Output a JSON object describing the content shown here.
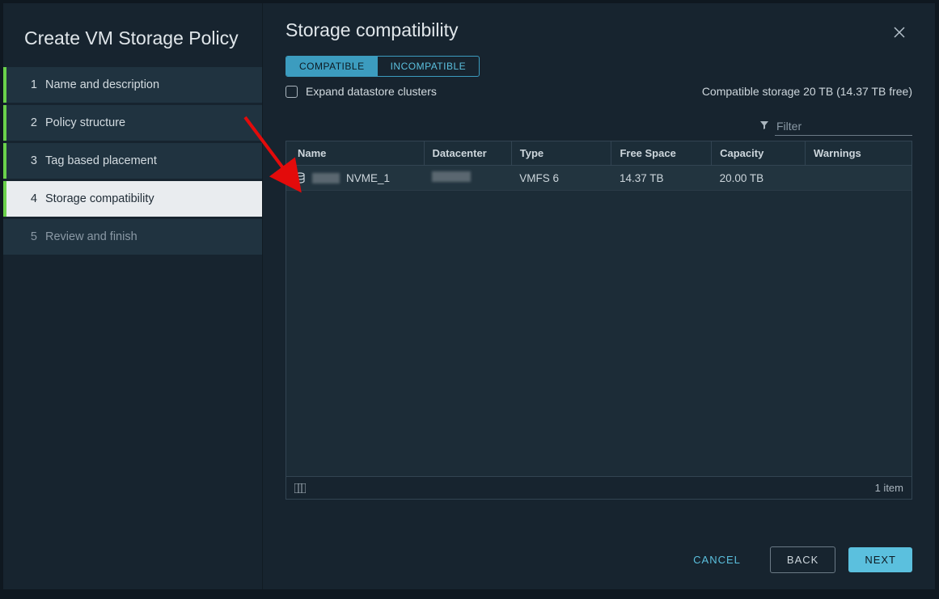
{
  "sidebar": {
    "title": "Create VM Storage Policy",
    "steps": [
      {
        "num": "1",
        "label": "Name and description",
        "state": "completed"
      },
      {
        "num": "2",
        "label": "Policy structure",
        "state": "completed"
      },
      {
        "num": "3",
        "label": "Tag based placement",
        "state": "completed"
      },
      {
        "num": "4",
        "label": "Storage compatibility",
        "state": "current"
      },
      {
        "num": "5",
        "label": "Review and finish",
        "state": "pending"
      }
    ]
  },
  "main": {
    "title": "Storage compatibility",
    "tabs": {
      "compatible": "COMPATIBLE",
      "incompatible": "INCOMPATIBLE"
    },
    "expand_label": "Expand datastore clusters",
    "summary": "Compatible storage 20 TB (14.37 TB free)",
    "filter_placeholder": "Filter",
    "columns": {
      "name": "Name",
      "datacenter": "Datacenter",
      "type": "Type",
      "free_space": "Free Space",
      "capacity": "Capacity",
      "warnings": "Warnings"
    },
    "rows": [
      {
        "name": "NVME_1",
        "datacenter": "",
        "type": "VMFS 6",
        "free_space": "14.37 TB",
        "capacity": "20.00 TB",
        "warnings": ""
      }
    ],
    "footer_count": "1 item"
  },
  "buttons": {
    "cancel": "CANCEL",
    "back": "BACK",
    "next": "NEXT"
  }
}
